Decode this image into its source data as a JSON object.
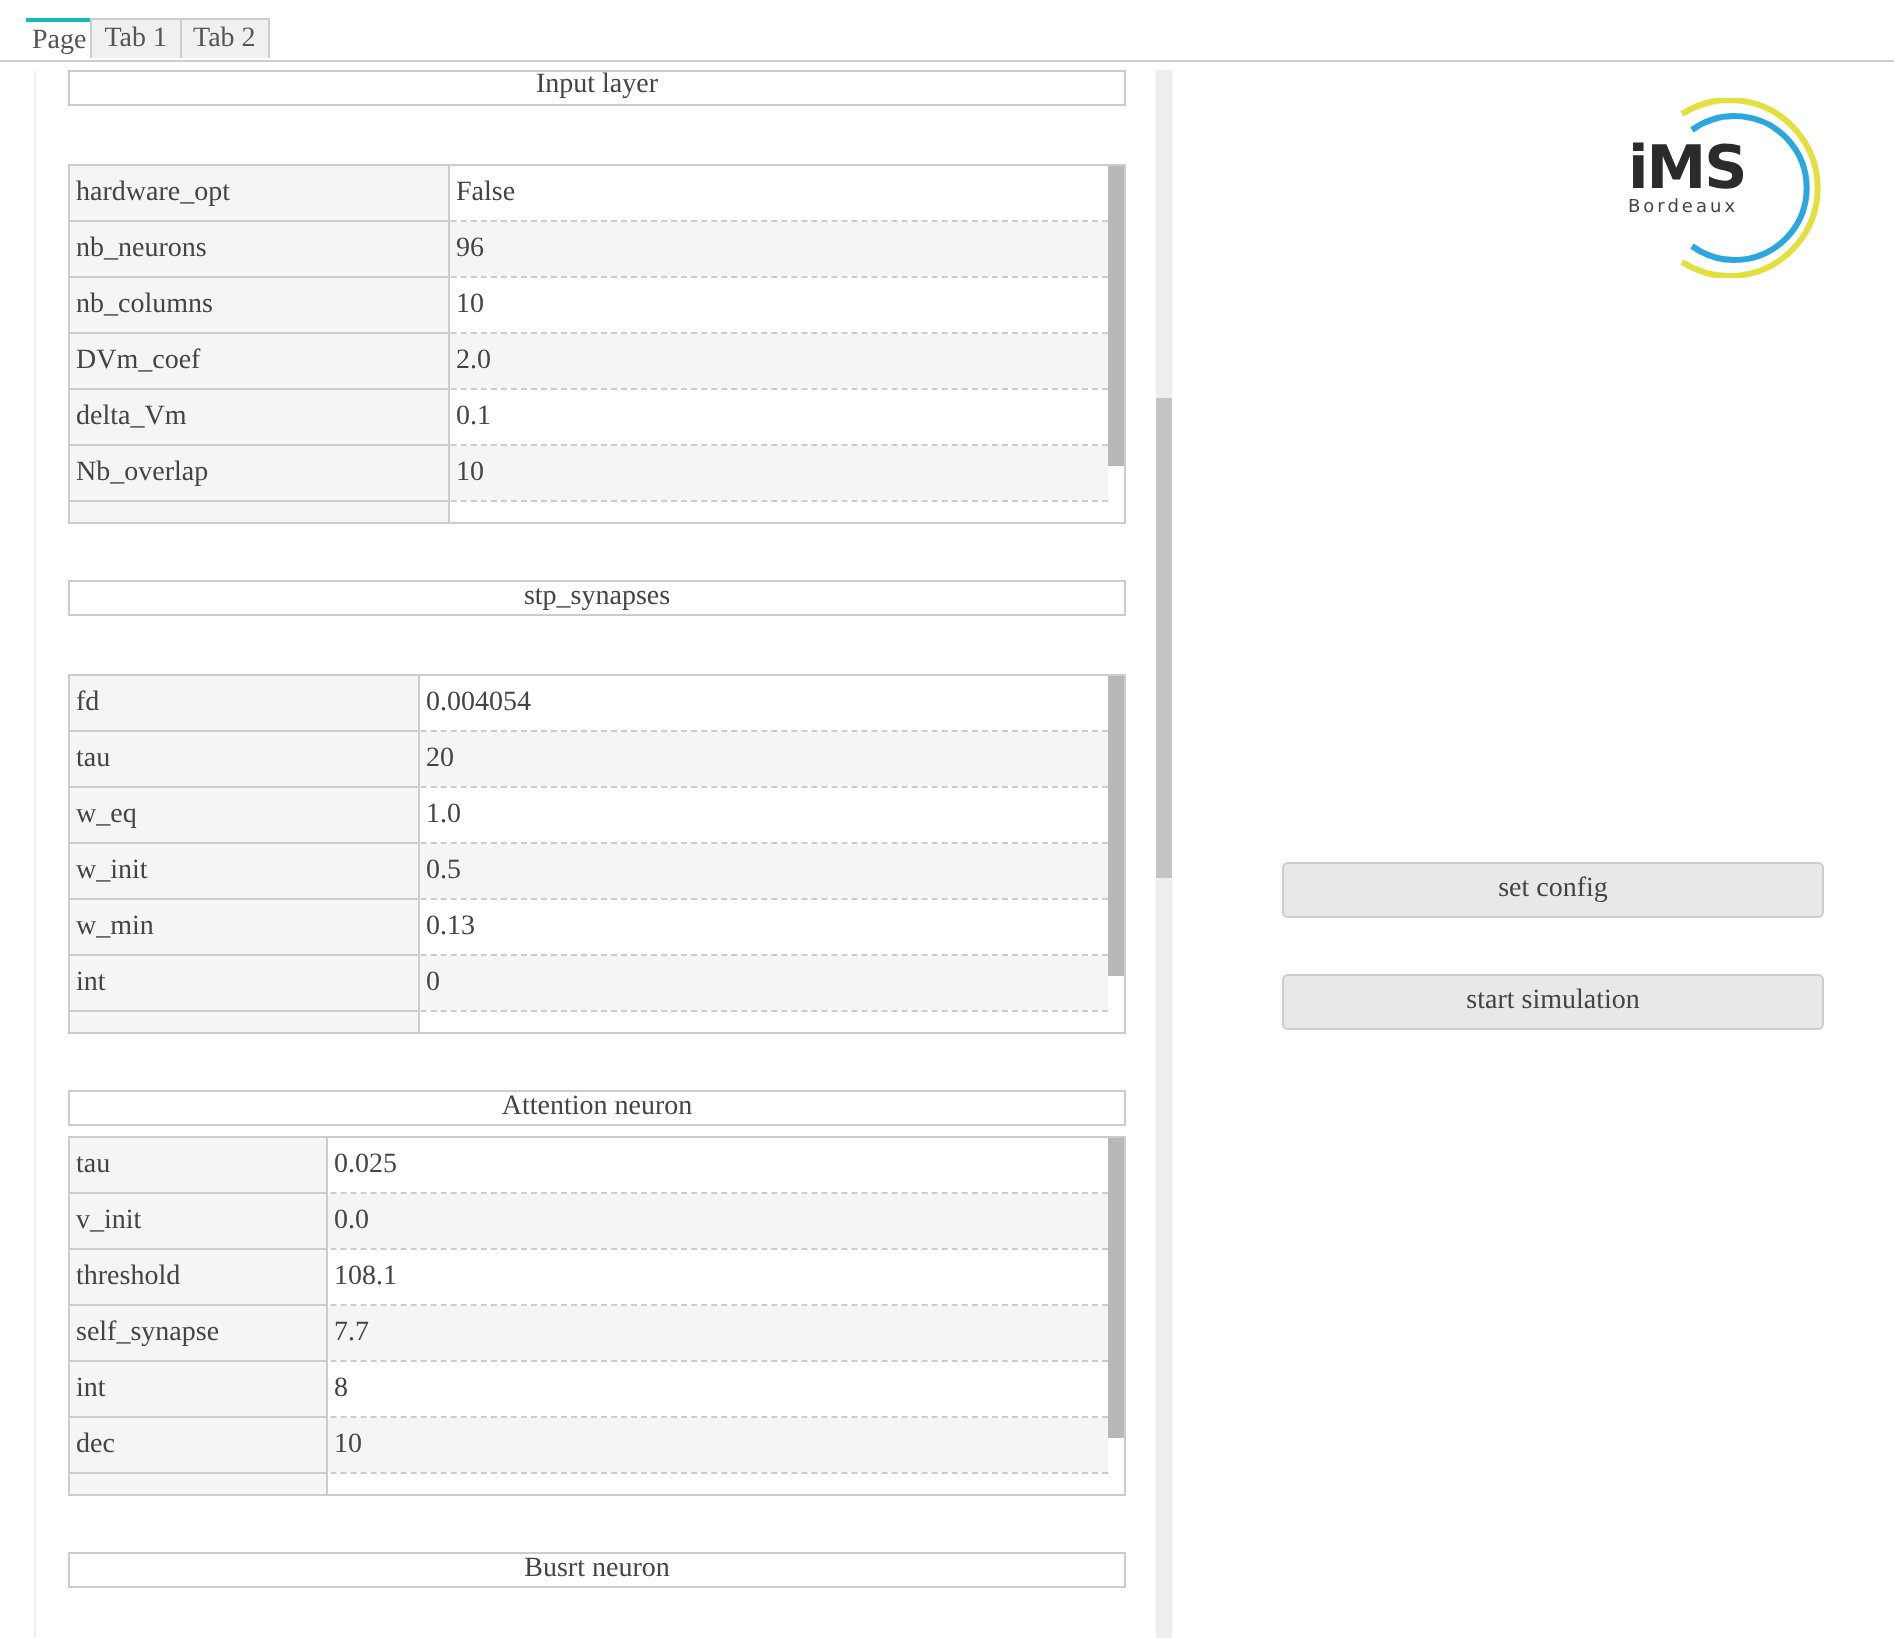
{
  "tabs": [
    {
      "label": "Page",
      "selected": true
    },
    {
      "label": "Tab 1",
      "selected": false
    },
    {
      "label": "Tab 2",
      "selected": false
    }
  ],
  "sections": [
    {
      "title": "Input layer",
      "rows": [
        {
          "key": "hardware_opt",
          "value": "False"
        },
        {
          "key": "nb_neurons",
          "value": "96"
        },
        {
          "key": "nb_columns",
          "value": "10"
        },
        {
          "key": "DVm_coef",
          "value": "2.0"
        },
        {
          "key": "delta_Vm",
          "value": "0.1"
        },
        {
          "key": "Nb_overlap",
          "value": "10"
        }
      ]
    },
    {
      "title": "stp_synapses",
      "rows": [
        {
          "key": "fd",
          "value": "0.004054"
        },
        {
          "key": "tau",
          "value": "20"
        },
        {
          "key": "w_eq",
          "value": "1.0"
        },
        {
          "key": "w_init",
          "value": "0.5"
        },
        {
          "key": "w_min",
          "value": "0.13"
        },
        {
          "key": "int",
          "value": "0"
        }
      ]
    },
    {
      "title": "Attention neuron",
      "rows": [
        {
          "key": "tau",
          "value": "0.025"
        },
        {
          "key": "v_init",
          "value": "0.0"
        },
        {
          "key": "threshold",
          "value": "108.1"
        },
        {
          "key": "self_synapse",
          "value": "7.7"
        },
        {
          "key": "int",
          "value": "8"
        },
        {
          "key": "dec",
          "value": "10"
        }
      ]
    },
    {
      "title": "Busrt neuron"
    }
  ],
  "logo": {
    "name": "iMS",
    "subtitle": "Bordeaux"
  },
  "buttons": [
    "set config",
    "start simulation"
  ]
}
